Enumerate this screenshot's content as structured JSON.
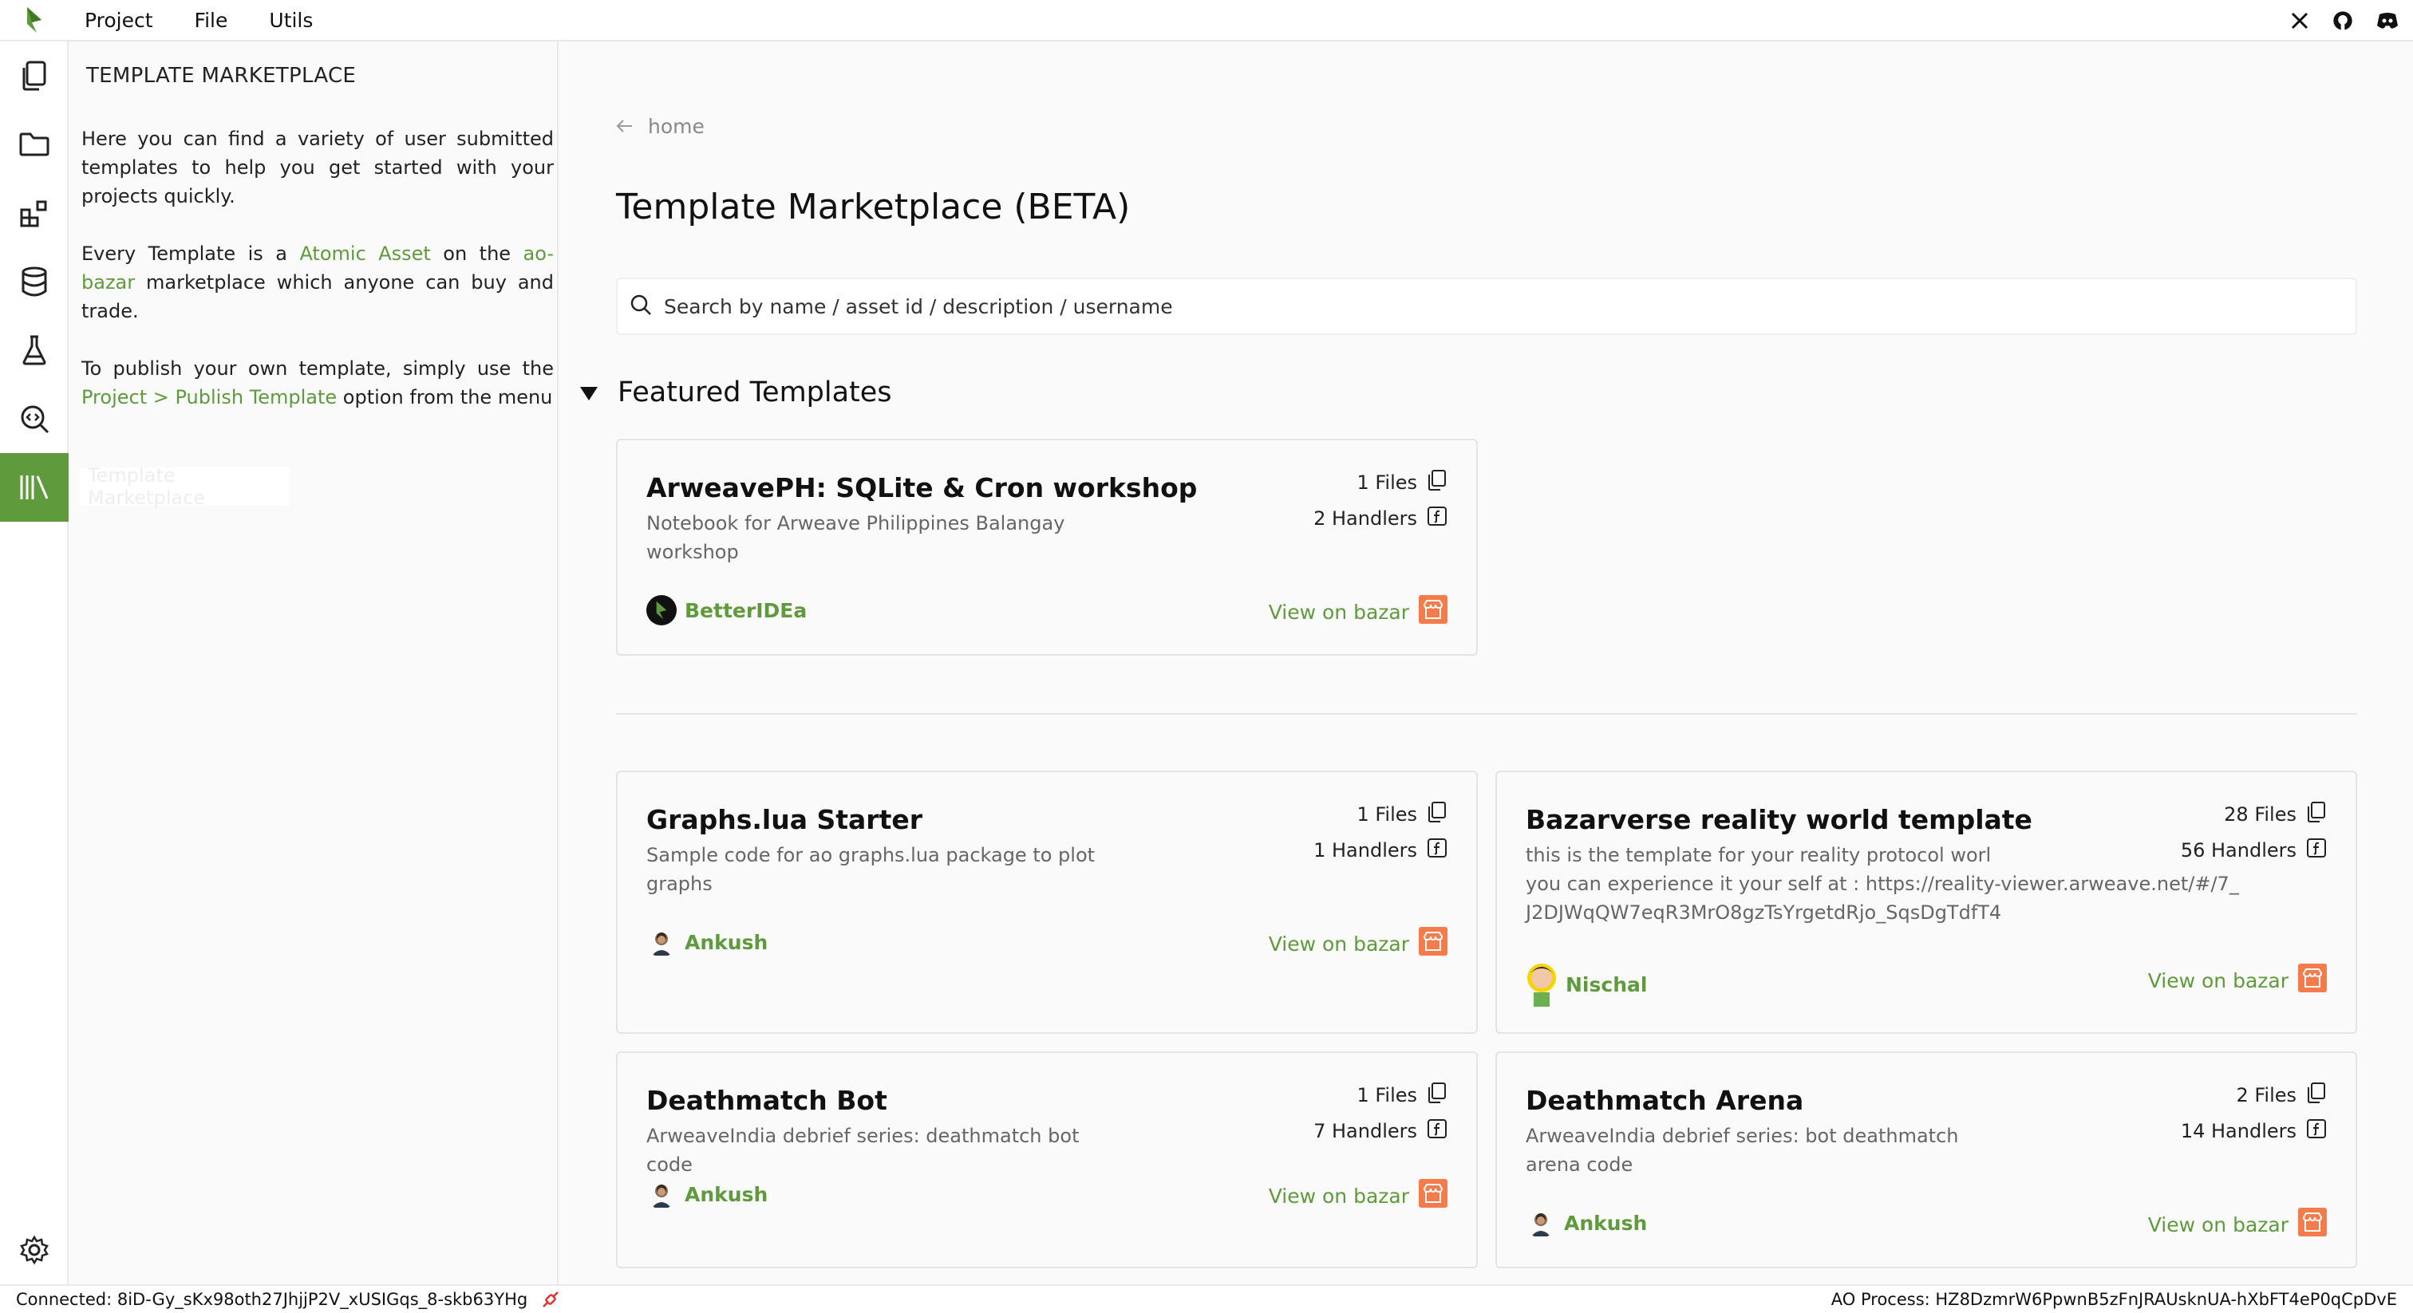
{
  "menubar": {
    "items": [
      "Project",
      "File",
      "Utils"
    ],
    "right_icons": [
      "x-twitter-icon",
      "github-icon",
      "discord-icon"
    ]
  },
  "activity_bar": {
    "icons": [
      "files-icon",
      "folder-icon",
      "packages-icon",
      "database-icon",
      "flask-icon",
      "search-code-icon",
      "library-icon"
    ],
    "active": "library-icon",
    "settings_icon": "gear-icon"
  },
  "side_panel": {
    "title": "TEMPLATE MARKETPLACE",
    "para1": "Here you can find a variety of user submitted templates to help you get started with your projects quickly.",
    "para2_a": "Every Template is a ",
    "para2_link1": "Atomic Asset",
    "para2_b": " on the ",
    "para2_link2": "ao-bazar",
    "para2_c": " marketplace which anyone can buy and trade.",
    "para3_a": "To publish your own template, simply use the ",
    "para3_link": "Project > Publish Template",
    "para3_b": " option from the menu",
    "tooltip": "Template Marketplace"
  },
  "main": {
    "breadcrumb": "home",
    "title": "Template Marketplace (BETA)",
    "search_placeholder": "Search by name / asset id / description / username",
    "featured_heading": "Featured Templates",
    "view_label": "View on bazar",
    "featured": {
      "title": "ArweavePH: SQLite & Cron workshop",
      "description": "Notebook for Arweave Philippines Balangay workshop",
      "files": "1 Files",
      "handlers": "2 Handlers",
      "author": "BetterIDEa"
    },
    "templates": [
      {
        "title": "Graphs.lua Starter",
        "description": "Sample code for ao graphs.lua package to plot graphs",
        "files": "1 Files",
        "handlers": "1 Handlers",
        "author": "Ankush"
      },
      {
        "title": "Bazarverse reality world template",
        "description_line1": "this is the template for your reality protocol worl",
        "description_line2": "you can experience it your self at : https://reality-viewer.arweave.net/#/7_J2DJWqQW7eqR3MrO8gzTsYrgetdRjo_SqsDgTdfT4",
        "files": "28 Files",
        "handlers": "56 Handlers",
        "author": "Nischal"
      },
      {
        "title": "Deathmatch Bot",
        "description": "ArweaveIndia debrief series: deathmatch bot code",
        "files": "1 Files",
        "handlers": "7 Handlers",
        "author": "Ankush"
      },
      {
        "title": "Deathmatch Arena",
        "description": "ArweaveIndia debrief series: bot deathmatch arena code",
        "files": "2 Files",
        "handlers": "14 Handlers",
        "author": "Ankush"
      }
    ]
  },
  "status_bar": {
    "connected": "Connected: 8iD-Gy_sKx98oth27JhjjP2V_xUSIGqs_8-skb63YHg",
    "process": "AO Process: HZ8DzmrW6PpwnB5zFnJRAUsknUA-hXbFT4eP0qCpDvE"
  },
  "colors": {
    "accent": "#5f9a3d",
    "bazar_orange": "#f47b4b"
  }
}
